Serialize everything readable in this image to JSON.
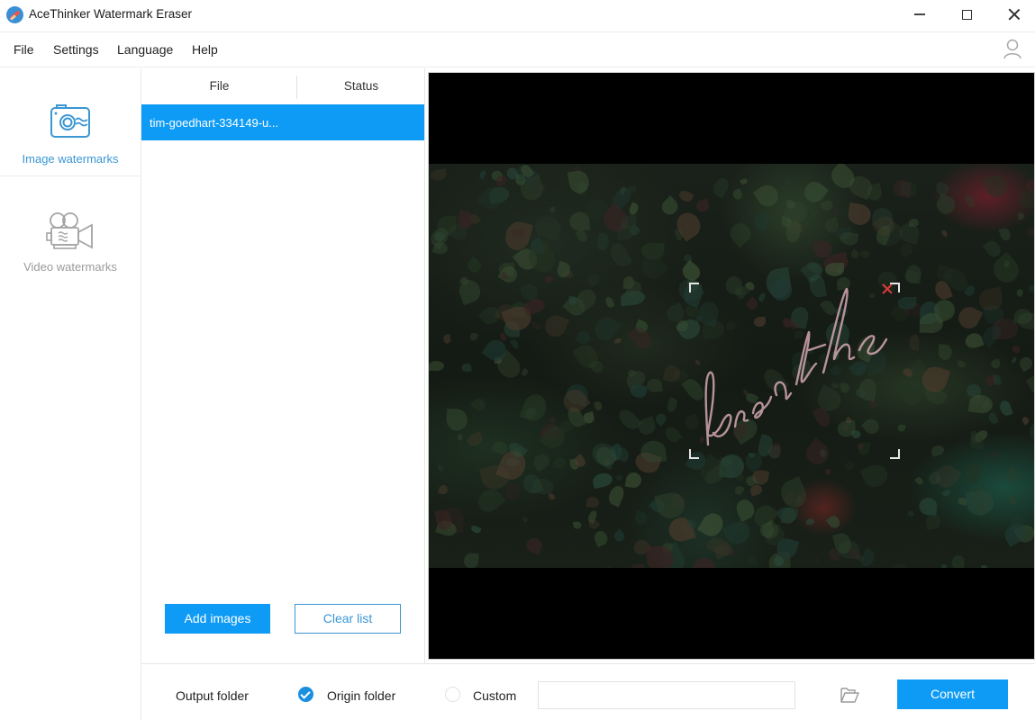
{
  "window": {
    "title": "AceThinker Watermark Eraser",
    "controls": {
      "minimize": "minimize",
      "maximize": "maximize",
      "close": "close"
    }
  },
  "menu": {
    "items": [
      {
        "label": "File"
      },
      {
        "label": "Settings"
      },
      {
        "label": "Language"
      },
      {
        "label": "Help"
      }
    ],
    "account_icon": "user-icon"
  },
  "sidebar": {
    "items": [
      {
        "label": "Image watermarks",
        "icon": "camera-icon",
        "active": true
      },
      {
        "label": "Video watermarks",
        "icon": "movie-camera-icon",
        "active": false
      }
    ]
  },
  "file_list": {
    "columns": [
      "File",
      "Status"
    ],
    "rows": [
      {
        "file": "tim-goedhart-334149-u...",
        "status": "",
        "selected": true
      }
    ],
    "add_button": "Add images",
    "clear_button": "Clear list"
  },
  "preview": {
    "watermark_text": "breathe",
    "selection_close_icon": "close-icon"
  },
  "output": {
    "label": "Output folder",
    "options": [
      {
        "label": "Origin folder",
        "checked": true
      },
      {
        "label": "Custom",
        "checked": false
      }
    ],
    "custom_path_value": "",
    "browse_icon": "folder-icon",
    "convert_button": "Convert"
  },
  "colors": {
    "accent": "#0e9bf5",
    "accent_text": "#3a97d4",
    "selection_close": "#e03a3a",
    "watermark": "#c9a0aa"
  }
}
